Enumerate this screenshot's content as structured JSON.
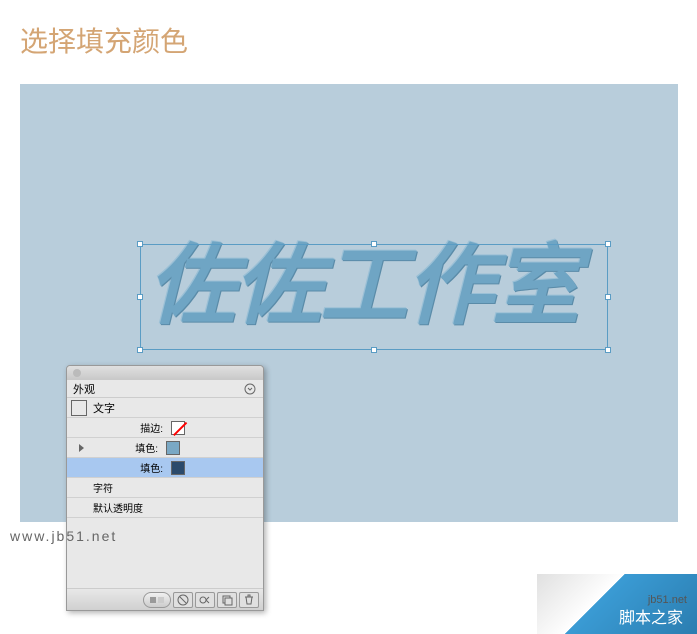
{
  "title": "选择填充颜色",
  "canvas": {
    "bg": "#b8cddb",
    "artwork_text": "佐佐工作室"
  },
  "panel": {
    "tab_label": "外观",
    "type_row": {
      "label": "文字",
      "swatch": "#7aa8c4"
    },
    "stroke_row": {
      "label": "描边:"
    },
    "fill1_row": {
      "label": "填色:",
      "swatch": "#7aa8c4"
    },
    "fill2_row": {
      "label": "填色:",
      "swatch": "#2b4a6b"
    },
    "char_row": {
      "label": "字符"
    },
    "opacity_row": {
      "label": "默认透明度"
    }
  },
  "watermark": "www.jb51.net",
  "corner": {
    "url": "jb51.net",
    "text": "脚本之家"
  }
}
